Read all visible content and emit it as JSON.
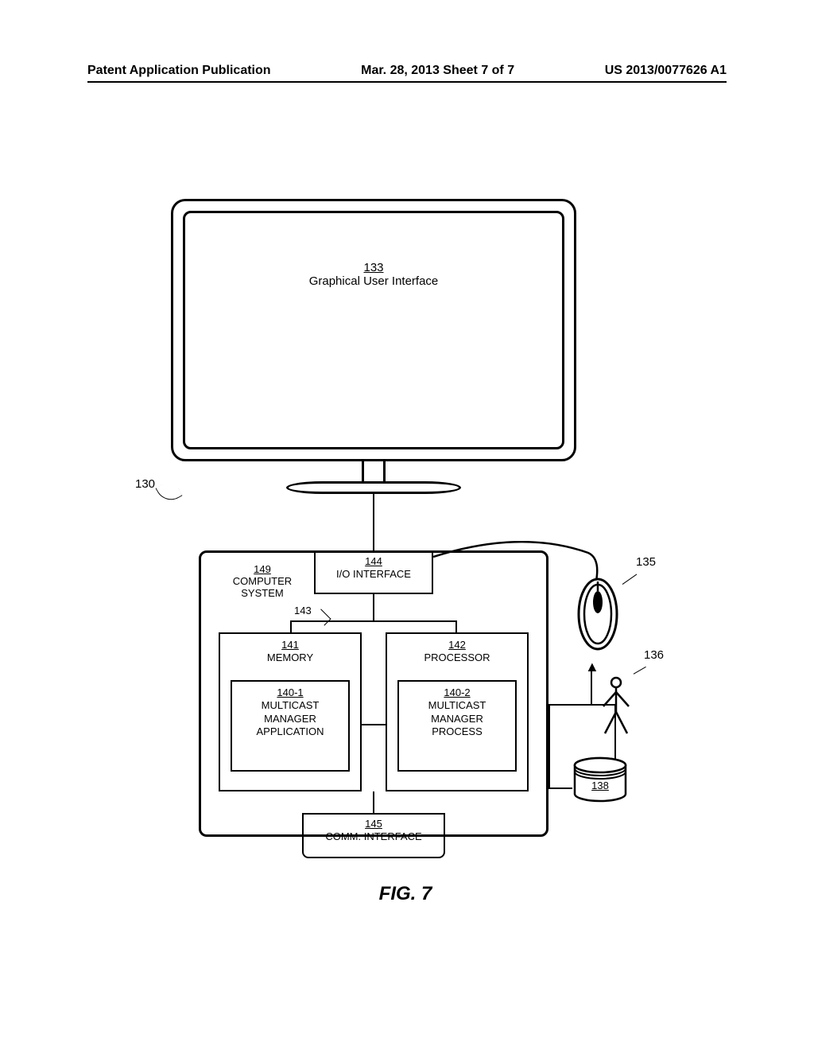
{
  "header": {
    "left": "Patent Application Publication",
    "center": "Mar. 28, 2013  Sheet 7 of 7",
    "right": "US 2013/0077626 A1"
  },
  "monitor": {
    "ref": "133",
    "label": "Graphical User Interface",
    "callout": "130"
  },
  "computer": {
    "system_ref": "149",
    "system_label": "COMPUTER SYSTEM",
    "io_ref": "144",
    "io_label": "I/O INTERFACE",
    "bus_ref": "143",
    "memory_ref": "141",
    "memory_label": "MEMORY",
    "processor_ref": "142",
    "processor_label": "PROCESSOR",
    "app_ref": "140-1",
    "app_label1": "MULTICAST",
    "app_label2": "MANAGER",
    "app_label3": "APPLICATION",
    "process_ref": "140-2",
    "process_label1": "MULTICAST",
    "process_label2": "MANAGER",
    "process_label3": "PROCESS",
    "comm_ref": "145",
    "comm_label": "COMM. INTERFACE"
  },
  "mouse": {
    "callout": "135"
  },
  "user": {
    "callout": "136"
  },
  "database": {
    "ref": "138"
  },
  "figure_label": "FIG. 7"
}
